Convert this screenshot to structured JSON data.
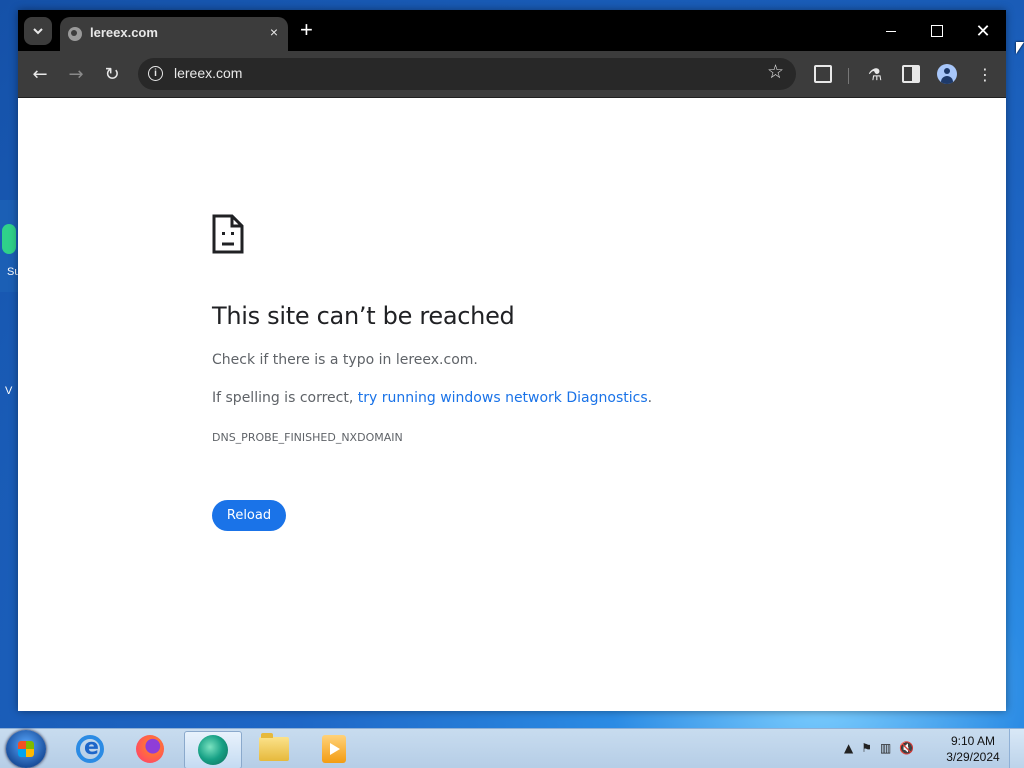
{
  "browser": {
    "tab": {
      "title": "lereex.com",
      "close": "×"
    },
    "new_tab": "+",
    "window_controls": {
      "minimize": "",
      "maximize": "",
      "close": "✕"
    },
    "toolbar": {
      "url": "lereex.com",
      "back": "←",
      "forward": "→",
      "reload": "↻",
      "star": "☆",
      "labs": "⚗",
      "menu": "⋮"
    }
  },
  "error_page": {
    "title": "This site can’t be reached",
    "line1": "Check if there is a typo in lereex.com.",
    "line2_prefix": "If spelling is correct, ",
    "line2_link": "try running windows network Diagnostics",
    "line2_suffix": ".",
    "error_code": "DNS_PROBE_FINISHED_NXDOMAIN",
    "reload_button": "Reload"
  },
  "taskbar": {
    "apps": [
      "internet-explorer",
      "firefox",
      "edge",
      "file-explorer",
      "media-player"
    ],
    "clock_time": "9:10 AM",
    "clock_date": "3/29/2024",
    "tray_chevron": "▲",
    "tray_flag": "⚑",
    "tray_network": "▥",
    "tray_volume": "🔇"
  },
  "desktop": {
    "icon_label_fragment_1": "Su",
    "icon_label_fragment_2": "V"
  },
  "colors": {
    "link": "#1a73e8",
    "reload_button": "#1a73e8",
    "chrome_toolbar": "#3c3c3c",
    "tabstrip": "#000000"
  }
}
